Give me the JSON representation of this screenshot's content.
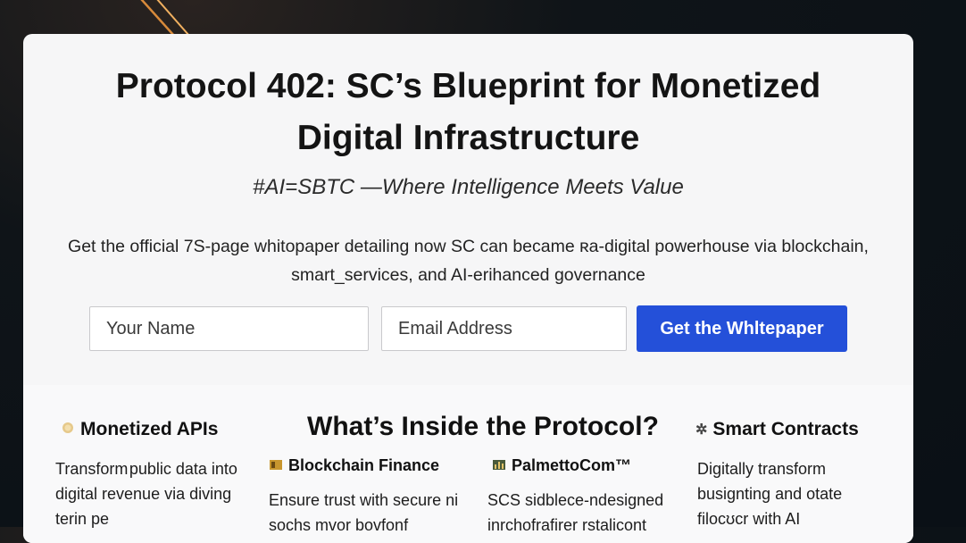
{
  "hero": {
    "title": "Protocol 402: SC’s Blueprint for Monetized Digital Infrastructure",
    "tagline": "#AI=SBTC —Where Intelligence Meets Value",
    "description": "Get the official 7S-page whitopaper detailing now SC can became ʀa-digital powerhouse via blockchain, smart_services, and AI-erihanced governance"
  },
  "form": {
    "name_placeholder": "Your Name",
    "email_placeholder": "Email Address",
    "submit_label": "Get the Whltepaper"
  },
  "inside": {
    "title": "What’s Inside the Protocol?",
    "features": [
      {
        "heading": "Monetized APIs",
        "icon": "coin-icon",
        "text": "Transform public data into digital revenue via diving terin pe"
      },
      {
        "heading": "Blockchain Finance",
        "icon": "ledger-icon",
        "text": "Ensure trust with secure ni sochs mvor bovfonf"
      },
      {
        "heading": "PalmettoCom™",
        "icon": "chart-icon",
        "text": "SCS sidblece-ndesigned inrchofrafirer rstalicont"
      },
      {
        "heading": "Smart Contracts",
        "icon": "gear-icon",
        "text": "Digitally transform busignting and otate filocʊcr with AI"
      }
    ]
  },
  "colors": {
    "accent": "#2450d9",
    "card": "#f6f6f7",
    "background": "#0c1218"
  }
}
